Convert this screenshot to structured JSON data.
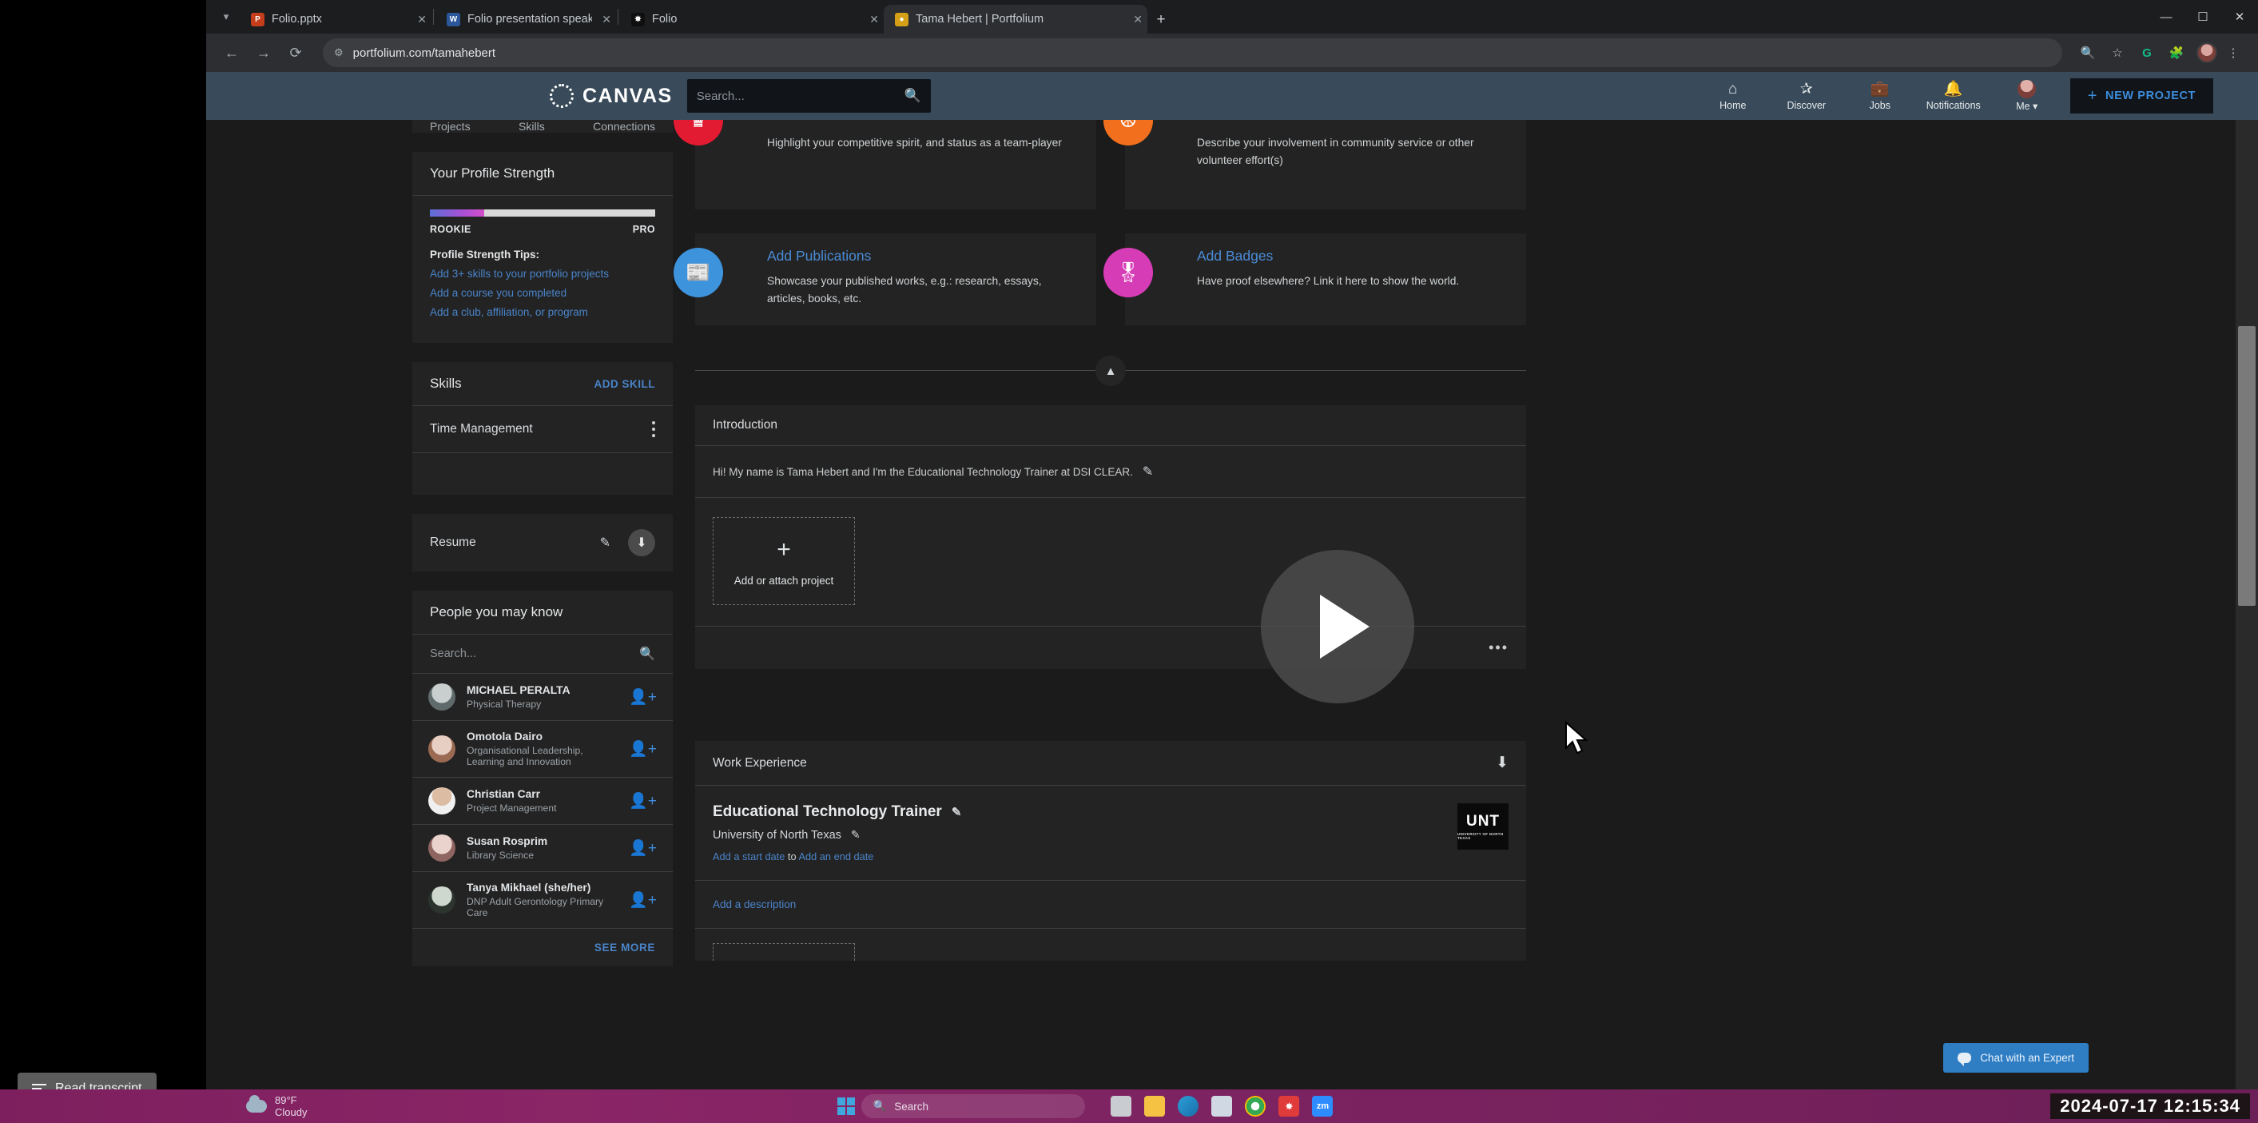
{
  "browser": {
    "tabs": [
      {
        "title": "Folio.pptx",
        "icon": "powerpoint-icon",
        "active": false
      },
      {
        "title": "Folio presentation speaker note",
        "icon": "word-icon",
        "active": false
      },
      {
        "title": "Folio",
        "icon": "folio-icon",
        "active": false
      },
      {
        "title": "Tama Hebert | Portfolium",
        "icon": "profile-icon",
        "active": true
      }
    ],
    "new_tab_label": "+",
    "window_controls": {
      "minimize": "—",
      "maximize": "☐",
      "close": "✕"
    },
    "nav": {
      "back": "←",
      "forward": "→",
      "reload": "⟳"
    },
    "omnibox": {
      "url": "portfolium.com/tamahebert",
      "site_info_icon": "site-settings-icon"
    },
    "toolbar_icons": [
      "zoom-icon",
      "bookmark-star-icon",
      "grammarly-icon",
      "extensions-icon",
      "profile-avatar-icon",
      "chrome-menu-icon"
    ]
  },
  "canvas_nav": {
    "brand": "CANVAS",
    "search_placeholder": "Search...",
    "items": [
      {
        "label": "Home",
        "icon": "home-icon",
        "glyph": "⌂"
      },
      {
        "label": "Discover",
        "icon": "compass-icon",
        "glyph": "✆"
      },
      {
        "label": "Jobs",
        "icon": "briefcase-icon",
        "glyph": "☕"
      },
      {
        "label": "Notifications",
        "icon": "bell-icon",
        "glyph": "⚑"
      },
      {
        "label": "Me",
        "icon": "account-avatar-icon",
        "glyph": ""
      }
    ],
    "new_project_label": "NEW PROJECT",
    "new_project_plus": "+"
  },
  "sidebar": {
    "profile_tabs": [
      "Projects",
      "Skills",
      "Connections"
    ],
    "profile_strength": {
      "title": "Your Profile Strength",
      "min_label": "ROOKIE",
      "max_label": "PRO",
      "progress_percent": 24,
      "tips_title": "Profile Strength Tips:",
      "tips": [
        "Add 3+ skills to your portfolio projects",
        "Add a course you completed",
        "Add a club, affiliation, or program"
      ]
    },
    "skills": {
      "title": "Skills",
      "add_label": "ADD SKILL",
      "items": [
        {
          "name": "Time Management"
        }
      ]
    },
    "resume": {
      "title": "Resume",
      "edit_icon": "pencil-icon",
      "download_icon": "download-icon"
    },
    "people": {
      "title": "People you may know",
      "search_placeholder": "Search...",
      "items": [
        {
          "name": "MICHAEL PERALTA",
          "subtitle": "Physical Therapy"
        },
        {
          "name": "Omotola Dairo",
          "subtitle": "Organisational Leadership, Learning and Innovation"
        },
        {
          "name": "Christian Carr",
          "subtitle": "Project Management"
        },
        {
          "name": "Susan Rosprim",
          "subtitle": "Library Science"
        },
        {
          "name": "Tanya Mikhael (she/her)",
          "subtitle": "DNP Adult Gerontology Primary Care"
        }
      ],
      "see_more_label": "SEE MORE"
    }
  },
  "main": {
    "promos": [
      {
        "title": "",
        "desc": "Highlight your competitive spirit, and status as a team-player",
        "color": "#e31b32",
        "icon": "trophy-icon",
        "glyph": "⚘"
      },
      {
        "title": "",
        "desc": "Describe your involvement in community service or other volunteer effort(s)",
        "color": "#f2701d",
        "icon": "volunteer-hand-icon",
        "glyph": "✋"
      },
      {
        "title": "Add Publications",
        "desc": "Showcase your published works, e.g.: research, essays, articles, books, etc.",
        "color": "#3e93dd",
        "icon": "newspaper-icon",
        "glyph": "▤"
      },
      {
        "title": "Add Badges",
        "desc": "Have proof elsewhere? Link it here to show the world.",
        "color": "#d63cb6",
        "icon": "award-ribbon-icon",
        "glyph": "❀"
      }
    ],
    "collapse_icon": "chevron-up-icon",
    "introduction": {
      "heading": "Introduction",
      "text": "Hi! My name is Tama Hebert and I'm the Educational Technology Trainer at DSI CLEAR.",
      "edit_icon": "pencil-icon"
    },
    "attach_project": {
      "plus": "+",
      "label": "Add or attach project"
    },
    "more_options": "•••",
    "work_experience": {
      "heading": "Work Experience",
      "collapse_icon": "arrow-down-icon",
      "items": [
        {
          "title": "Educational Technology Trainer",
          "organization": "University of North Texas",
          "start_date_link": "Add a start date",
          "date_joiner": "to",
          "end_date_link": "Add an end date",
          "logo_text": "UNT",
          "logo_sub": "UNIVERSITY OF NORTH TEXAS",
          "description_link": "Add a description"
        }
      ]
    },
    "play_overlay_icon": "play-button-icon"
  },
  "chat_widget": {
    "label": "Chat with an Expert",
    "icon": "chat-bubble-icon"
  },
  "read_transcript": {
    "label": "Read transcript",
    "icon": "transcript-icon"
  },
  "taskbar": {
    "weather": {
      "temperature": "89°F",
      "condition": "Cloudy",
      "icon": "cloud-icon"
    },
    "start_icon": "windows-logo-icon",
    "search_placeholder": "Search",
    "apps": [
      {
        "name": "task-view-icon",
        "color": "#c9ccd1",
        "glyph": ""
      },
      {
        "name": "file-explorer-icon",
        "color": "#f5c244",
        "glyph": ""
      },
      {
        "name": "edge-icon",
        "color": "#2b9fd8",
        "glyph": ""
      },
      {
        "name": "store-icon",
        "color": "#cfd8e3",
        "glyph": ""
      },
      {
        "name": "chrome-icon",
        "color": "#34a853",
        "glyph": ""
      },
      {
        "name": "folio-app-icon",
        "color": "#e03b3b",
        "glyph": ""
      },
      {
        "name": "zoom-app-icon",
        "color": "#2d8cff",
        "glyph": "zm"
      }
    ],
    "clock": "2024-07-17 12:15:34"
  }
}
